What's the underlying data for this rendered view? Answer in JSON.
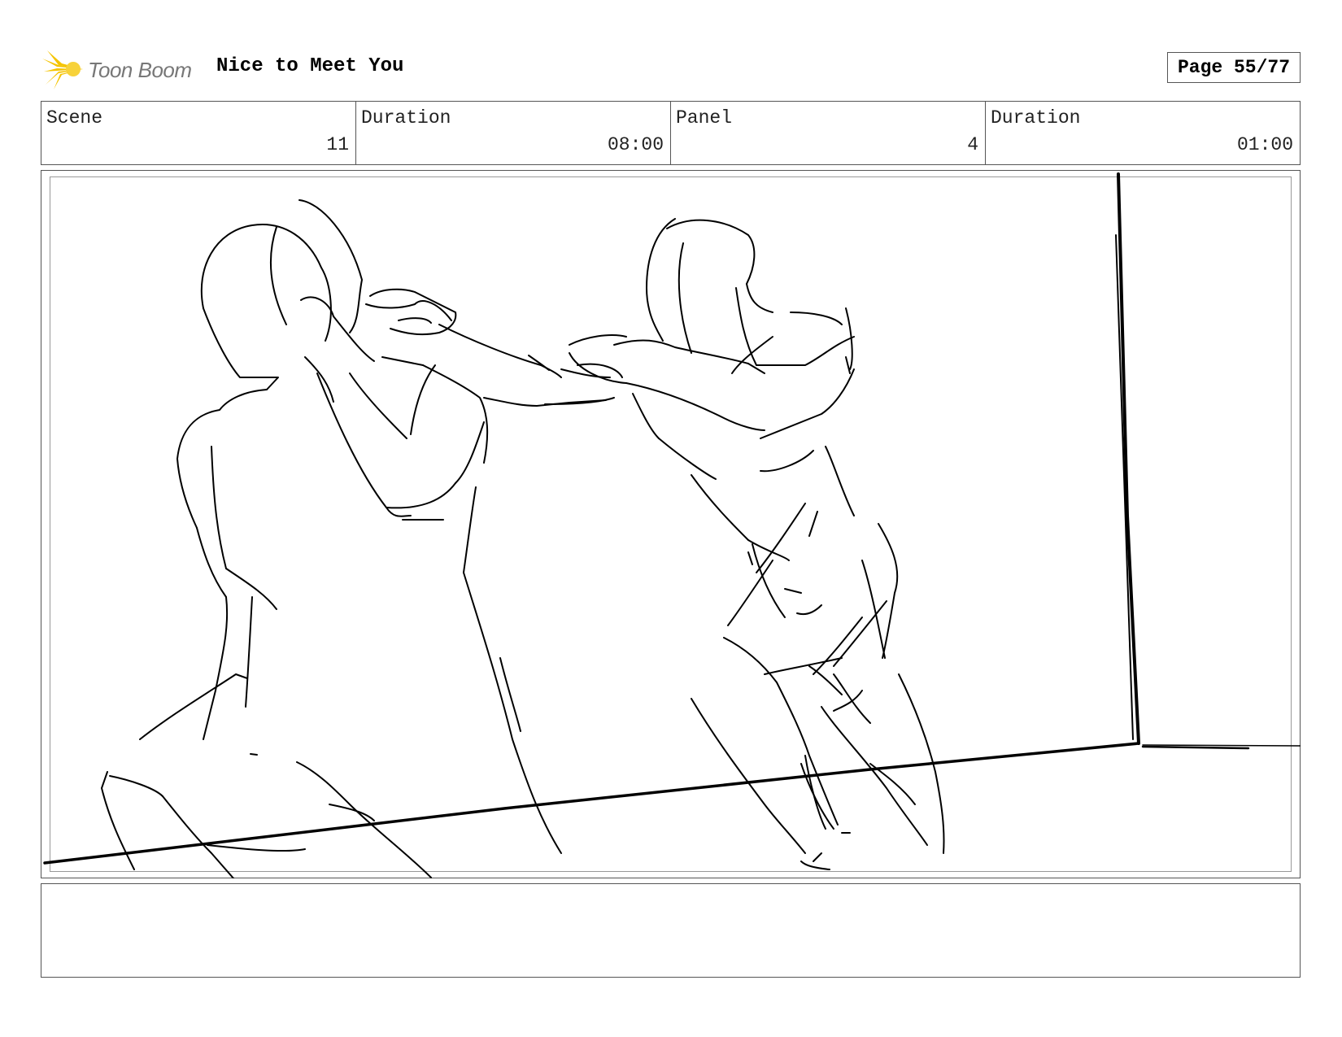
{
  "header": {
    "logo_text": "Toon Boom",
    "project_title": "Nice to Meet You",
    "page": "Page 55/77"
  },
  "info": {
    "scene_label": "Scene",
    "scene_value": "11",
    "scene_duration_label": "Duration",
    "scene_duration_value": "08:00",
    "panel_label": "Panel",
    "panel_value": "4",
    "panel_duration_label": "Duration",
    "panel_duration_value": "01:00"
  },
  "panel": {
    "image": "rough-sketch-two-figures-fighting",
    "notes": ""
  },
  "colors": {
    "logo_accent": "#f5c400",
    "border": "#555555",
    "ink": "#000000"
  }
}
